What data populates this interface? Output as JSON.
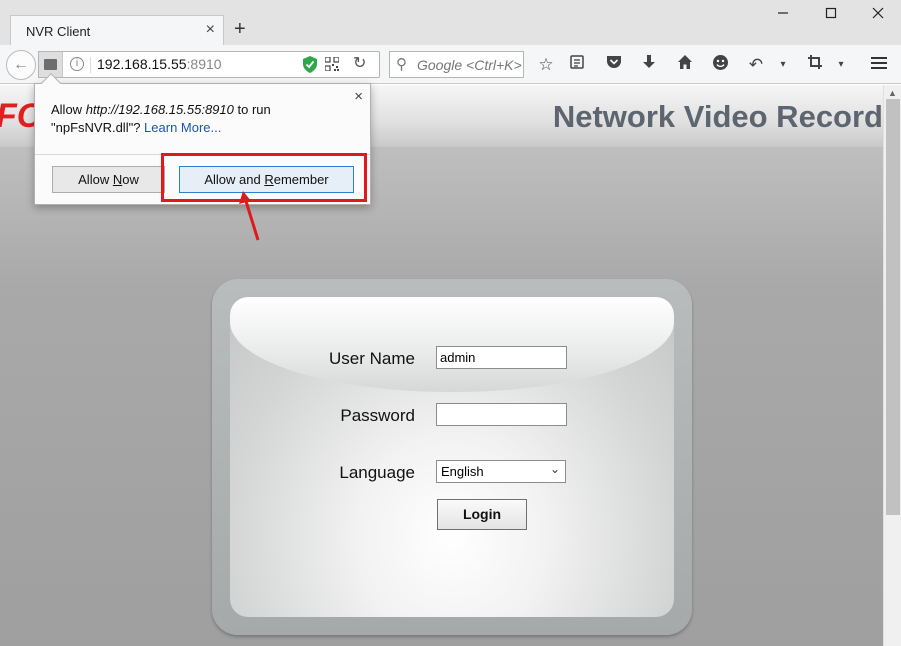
{
  "browser": {
    "tab_title": "NVR Client",
    "tab_close": "×",
    "new_tab": "+",
    "url_host": "192.168.15.55",
    "url_port": ":8910",
    "search_placeholder": "Google <Ctrl+K>",
    "window_controls": [
      "minimize-icon",
      "maximize-icon",
      "close-icon"
    ],
    "toolbar_icons": [
      "star-icon",
      "reading-list-icon",
      "pocket-icon",
      "download-icon",
      "home-icon",
      "smiley-icon",
      "undo-icon",
      "crop-icon",
      "menu-icon"
    ]
  },
  "popup": {
    "prefix": "Allow ",
    "url": "http://192.168.15.55:8910",
    "suffix": " to run",
    "plugin": "\"npFsNVR.dll\"? ",
    "learn_more": "Learn More...",
    "allow_now_pre": "Allow ",
    "allow_now_u": "N",
    "allow_now_post": "ow",
    "allow_remember_pre": "Allow and ",
    "allow_remember_u": "R",
    "allow_remember_post": "emember",
    "close": "×"
  },
  "page": {
    "header_logo": "FC",
    "header_title": "Network Video Record",
    "login": {
      "username_label": "User Name",
      "username_value": "admin",
      "password_label": "Password",
      "password_value": "",
      "language_label": "Language",
      "language_value": "English",
      "login_button": "Login"
    }
  },
  "colors": {
    "highlight": "#e01a1a",
    "link": "#1a56b0",
    "header_title": "#5d6670"
  }
}
